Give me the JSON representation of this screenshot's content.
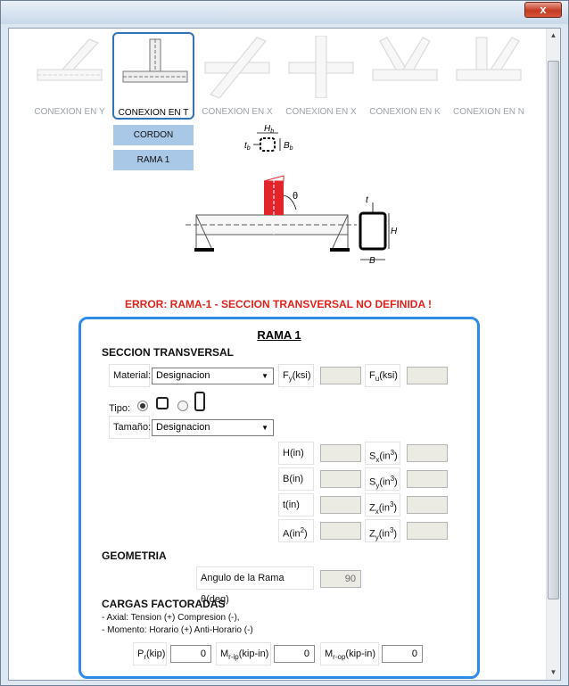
{
  "window": {
    "close_label": "x"
  },
  "connections": [
    {
      "label": "CONEXION EN Y",
      "selected": false
    },
    {
      "label": "CONEXION EN T",
      "selected": true
    },
    {
      "label": "CONEXION EN X",
      "selected": false
    },
    {
      "label": "CONEXION EN X",
      "selected": false
    },
    {
      "label": "CONEXION EN K",
      "selected": false
    },
    {
      "label": "CONEXION EN N",
      "selected": false
    }
  ],
  "members": {
    "cordon": "CORDON",
    "rama": "RAMA 1"
  },
  "diagram": {
    "hb": "H",
    "hb_sub": "b",
    "bb": "B",
    "bb_sub": "b",
    "tb": "t",
    "tb_sub": "b",
    "theta": "θ",
    "t": "t",
    "H": "H",
    "B": "B"
  },
  "error": "ERROR: RAMA-1 - SECCION TRANSVERSAL NO DEFINIDA !",
  "panel": {
    "title": "RAMA 1",
    "section_title": "SECCION TRANSVERSAL",
    "material_label": "Material:",
    "material_value": "Designacion",
    "fy_label": "F",
    "fy_sub": "y",
    "fy_unit": "(ksi)",
    "fu_label": "F",
    "fu_sub": "u",
    "fu_unit": "(ksi)",
    "tipo_label": "Tipo:",
    "tamano_label": "Tamaño:",
    "tamano_value": "Designacion",
    "props": {
      "h": "H(in)",
      "b": "B(in)",
      "t": "t(in)",
      "a": "A(in",
      "a_sup": "2",
      "a_close": ")",
      "sx": "S",
      "sx_sub": "x",
      "sy": "S",
      "sy_sub": "y",
      "zx": "Z",
      "zx_sub": "x",
      "zy": "Z",
      "zy_sub": "y",
      "unit_open": "(in",
      "unit_sup": "3",
      "unit_close": ")"
    },
    "geometry_title": "GEOMETRIA",
    "angle_label": "Angulo de la Rama θ(deg)",
    "angle_value": "90",
    "loads_title": "CARGAS FACTORADAS",
    "note1": "- Axial: Tension (+) Compresion (-),",
    "note2": "- Momento: Horario (+) Anti-Horario (-)",
    "pr_label": "P",
    "pr_sub": "r",
    "pr_unit": "(kip)",
    "pr_value": "0",
    "mrip_label": "M",
    "mrip_sub": "r-ip",
    "mrip_unit": "(kip-in)",
    "mrip_value": "0",
    "mrop_label": "M",
    "mrop_sub": "r-op",
    "mrop_unit": "(kip-in)",
    "mrop_value": "0"
  }
}
